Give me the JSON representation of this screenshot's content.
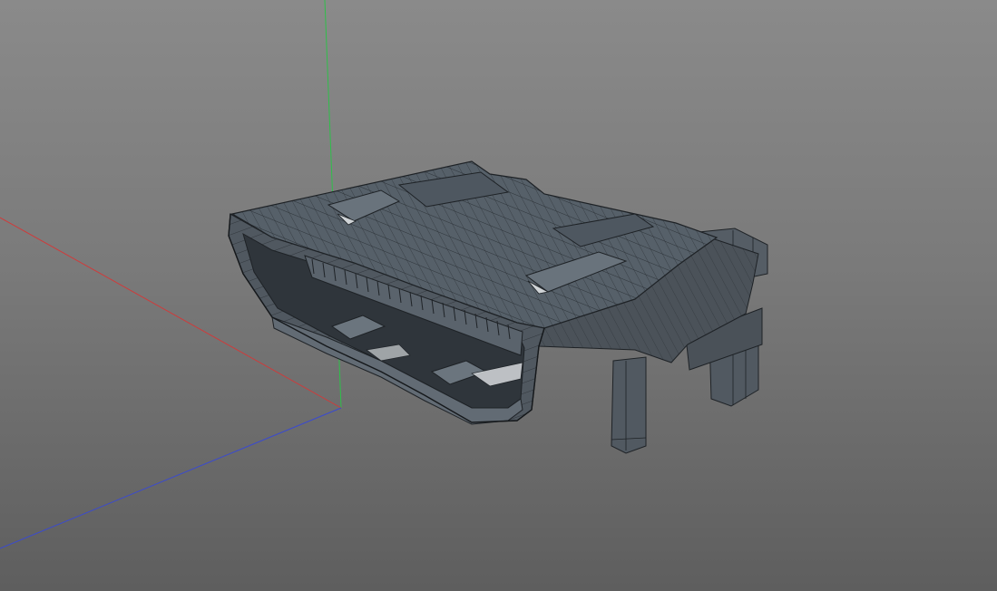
{
  "viewport": {
    "background": "gradient-gray",
    "axis_colors": {
      "x": "#d03a3a",
      "y": "#2fbf4a",
      "z": "#3a4ad0"
    },
    "model": {
      "type": "hdmi-connector",
      "display_mode": "wireframe-on-shaded",
      "shade_color": "#4f565e",
      "edge_color": "#1e2226"
    }
  }
}
